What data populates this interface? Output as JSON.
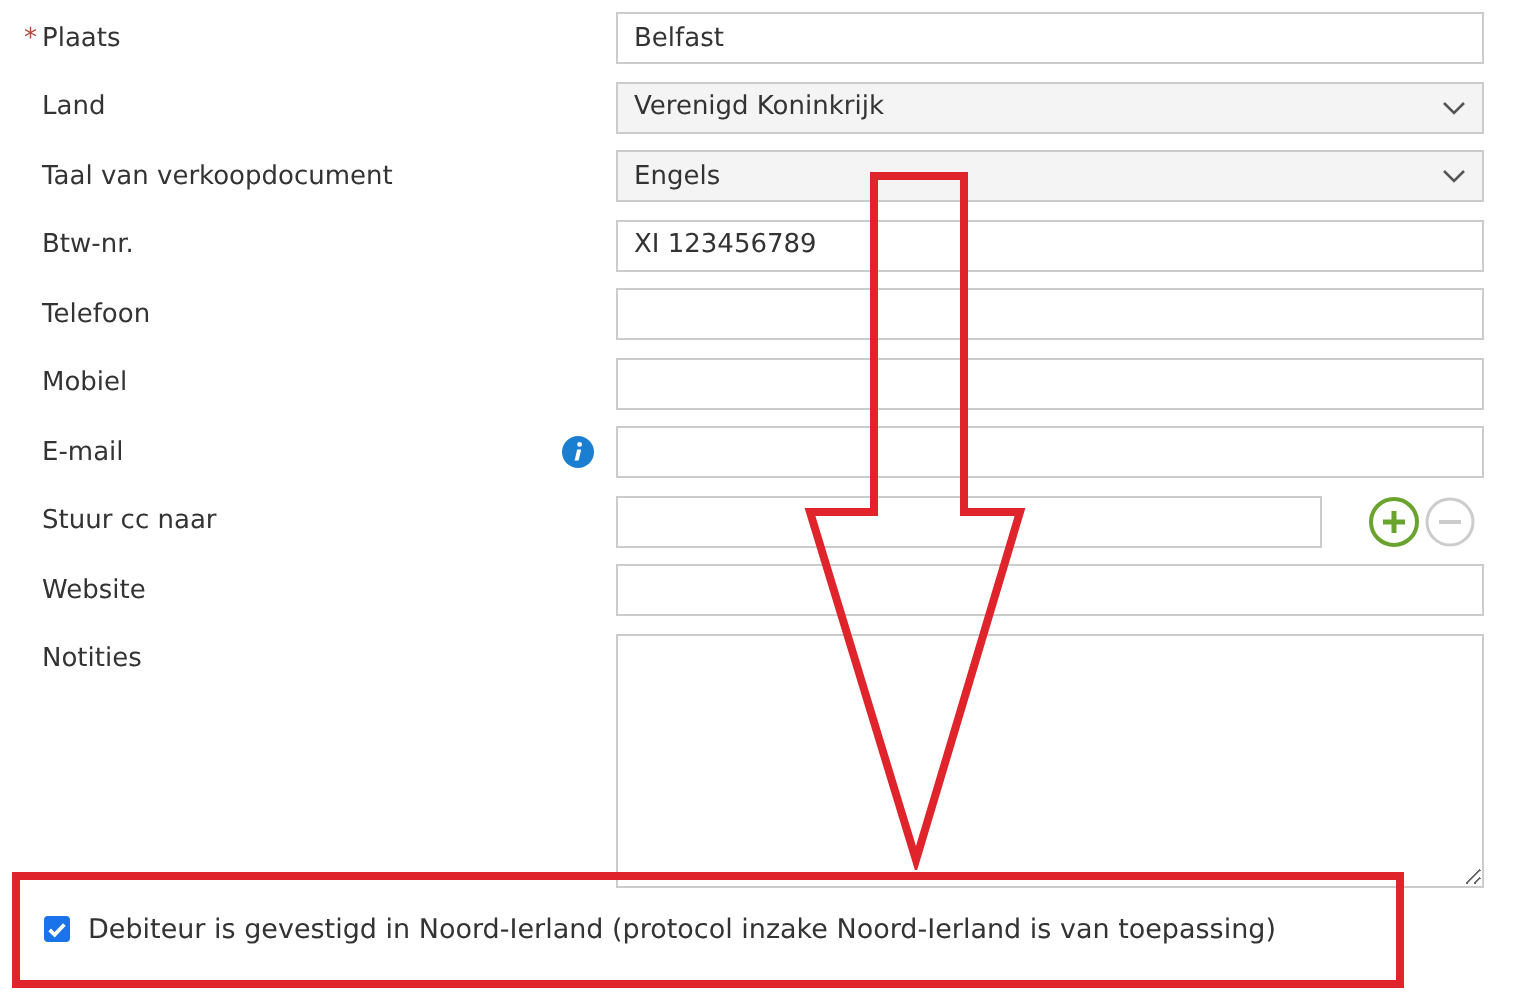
{
  "fields": [
    {
      "marker": "*",
      "label": "Plaats",
      "kind": "text",
      "value": "Belfast"
    },
    {
      "label": "Land",
      "kind": "select",
      "value": "Verenigd Koninkrijk"
    },
    {
      "label": "Taal van verkoopdocument",
      "kind": "select",
      "value": "Engels"
    },
    {
      "label": "Btw-nr.",
      "kind": "text",
      "value": "XI 123456789"
    },
    {
      "label": "Telefoon",
      "kind": "text"
    },
    {
      "label": "Mobiel",
      "kind": "text"
    },
    {
      "label": "E-mail",
      "kind": "text",
      "info": true
    },
    {
      "label": "Stuur cc naar",
      "kind": "multi"
    },
    {
      "label": "Website",
      "kind": "text"
    },
    {
      "label": "Notities",
      "kind": "textarea"
    }
  ],
  "checkbox": {
    "label": "Debiteur is gevestigd in Noord-Ierland (protocol inzake Noord-Ierland is van toepassing)",
    "checked": true
  }
}
